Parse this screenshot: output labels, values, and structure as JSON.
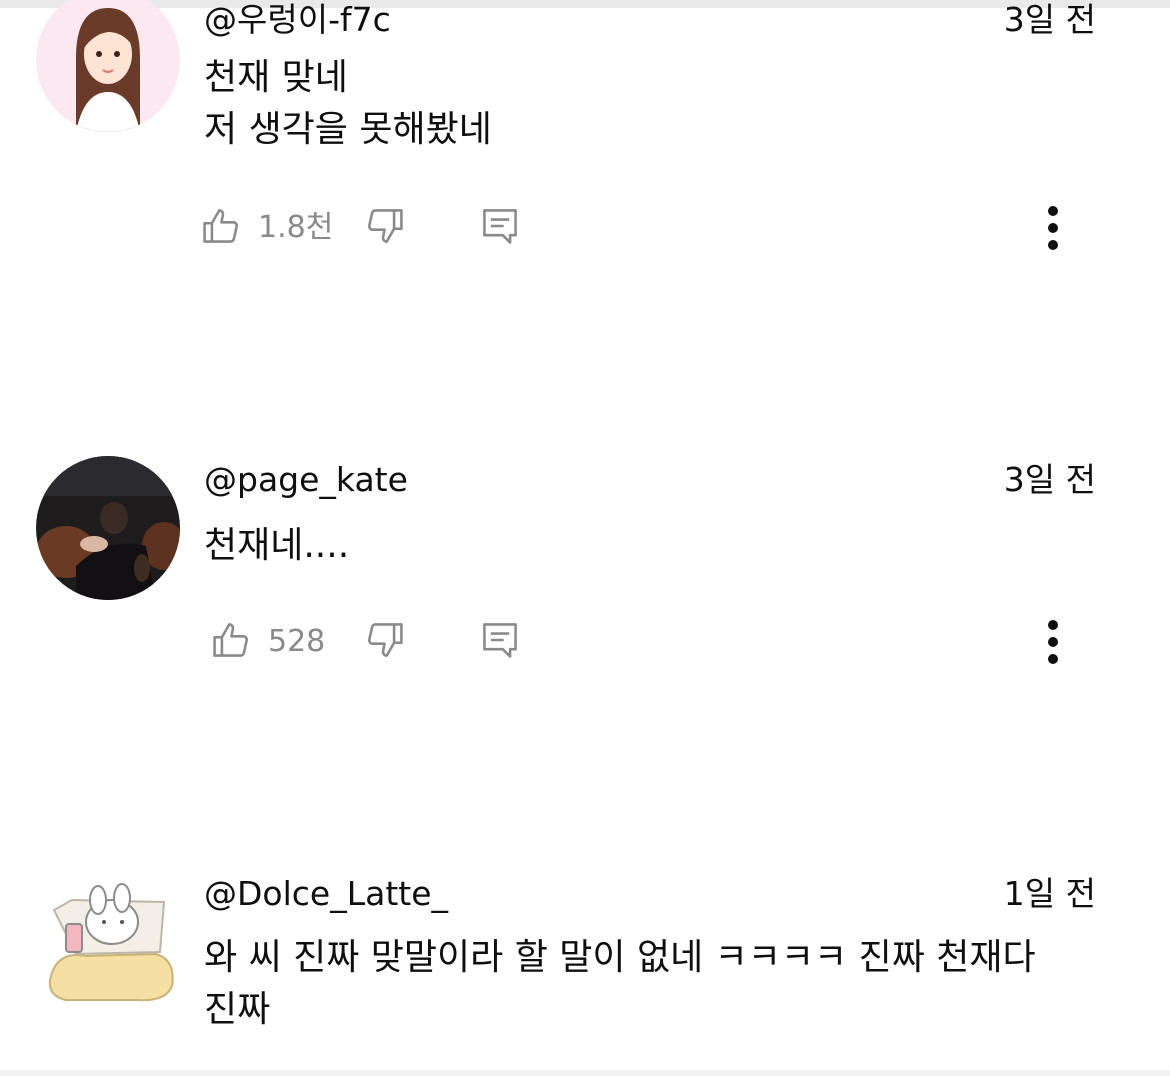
{
  "comments": [
    {
      "handle": "@우렁이-f7c",
      "time": "3일 전",
      "lines": [
        "천재 맞네",
        "저 생각을 못해봤네"
      ],
      "likes": "1.8천"
    },
    {
      "handle": "@page_kate",
      "time": "3일 전",
      "lines": [
        "천재네...."
      ],
      "likes": "528"
    },
    {
      "handle": "@Dolce_Latte_",
      "time": "1일 전",
      "lines": [
        "와 씨 진짜 맞말이라 할 말이 없네 ㅋㅋㅋㅋ 진짜 천재다",
        "진짜"
      ]
    }
  ],
  "icons": {
    "like": "thumbs-up-icon",
    "dislike": "thumbs-down-icon",
    "reply": "reply-icon",
    "more": "more-vertical-icon"
  },
  "colors": {
    "text": "#0f0f0f",
    "secondary": "#8a8a8a",
    "background": "#ffffff"
  }
}
